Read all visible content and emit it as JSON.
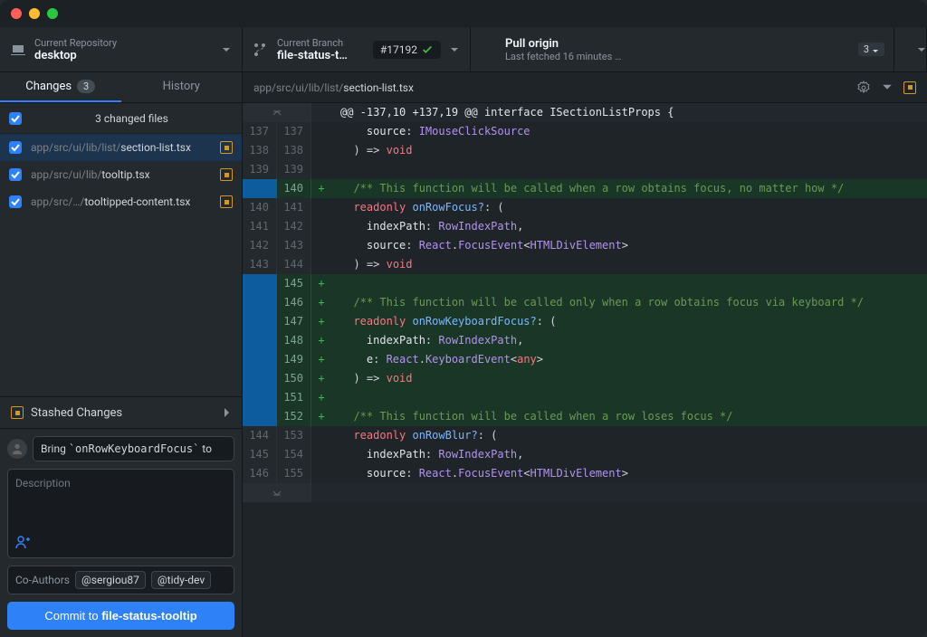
{
  "toolbar": {
    "repo": {
      "label": "Current Repository",
      "value": "desktop"
    },
    "branch": {
      "label": "Current Branch",
      "value": "file-status-t…",
      "pr_number": "#17192"
    },
    "fetch": {
      "label": "Pull origin",
      "sub": "Last fetched 16 minutes …",
      "count": "3"
    }
  },
  "tabs": {
    "changes": "Changes",
    "changes_count": "3",
    "history": "History"
  },
  "files": {
    "header": "3 changed files",
    "items": [
      {
        "dir": "app/src/ui/lib/list/",
        "name": "section-list.tsx"
      },
      {
        "dir": "app/src/ui/lib/",
        "name": "tooltip.tsx"
      },
      {
        "dir": "app/src/…/",
        "name": "tooltipped-content.tsx"
      }
    ]
  },
  "stashed": "Stashed Changes",
  "commit": {
    "summary_pre": "Bring ",
    "summary_code": "`onRowKeyboardFocus`",
    "summary_post": " to",
    "desc_placeholder": "Description",
    "coauthors_label": "Co-Authors",
    "handles": [
      "@sergiou87",
      "@tidy-dev"
    ],
    "btn_pre": "Commit to ",
    "btn_bold": "file-status-tooltip"
  },
  "file_header": {
    "dir": "app/src/ui/lib/list/",
    "name": "section-list.tsx"
  },
  "diff": [
    {
      "t": "hunk",
      "o": "",
      "n": "",
      "m": "",
      "segs": [
        [
          "plain",
          "@@ -137,10 +137,19 @@ interface ISectionListProps {"
        ]
      ]
    },
    {
      "t": "ctx",
      "o": "137",
      "n": "137",
      "m": "",
      "segs": [
        [
          "plain",
          "    source"
        ],
        [
          "punc",
          ": "
        ],
        [
          "type",
          "IMouseClickSource"
        ]
      ]
    },
    {
      "t": "ctx",
      "o": "138",
      "n": "138",
      "m": "",
      "segs": [
        [
          "punc",
          "  ) "
        ],
        [
          "punc",
          "=> "
        ],
        [
          "kw",
          "void"
        ]
      ]
    },
    {
      "t": "ctx",
      "o": "139",
      "n": "139",
      "m": "",
      "segs": [
        [
          "plain",
          ""
        ]
      ]
    },
    {
      "t": "add",
      "o": "",
      "n": "140",
      "m": "+",
      "segs": [
        [
          "comment",
          "  /** This function will be called when a row obtains focus, no matter how */"
        ]
      ]
    },
    {
      "t": "ctx",
      "o": "140",
      "n": "141",
      "m": "",
      "segs": [
        [
          "kw",
          "  readonly"
        ],
        [
          "plain",
          " "
        ],
        [
          "prop",
          "onRowFocus?"
        ],
        [
          "punc",
          ": ("
        ]
      ]
    },
    {
      "t": "ctx",
      "o": "141",
      "n": "142",
      "m": "",
      "segs": [
        [
          "plain",
          "    indexPath"
        ],
        [
          "punc",
          ": "
        ],
        [
          "type",
          "RowIndexPath"
        ],
        [
          "punc",
          ","
        ]
      ]
    },
    {
      "t": "ctx",
      "o": "142",
      "n": "143",
      "m": "",
      "segs": [
        [
          "plain",
          "    source"
        ],
        [
          "punc",
          ": "
        ],
        [
          "type",
          "React"
        ],
        [
          "punc",
          "."
        ],
        [
          "type",
          "FocusEvent"
        ],
        [
          "punc",
          "<"
        ],
        [
          "type",
          "HTMLDivElement"
        ],
        [
          "punc",
          ">"
        ]
      ]
    },
    {
      "t": "ctx",
      "o": "143",
      "n": "144",
      "m": "",
      "segs": [
        [
          "punc",
          "  ) "
        ],
        [
          "punc",
          "=> "
        ],
        [
          "kw",
          "void"
        ]
      ]
    },
    {
      "t": "add",
      "o": "",
      "n": "145",
      "m": "+",
      "segs": [
        [
          "plain",
          ""
        ]
      ]
    },
    {
      "t": "add",
      "o": "",
      "n": "146",
      "m": "+",
      "segs": [
        [
          "comment",
          "  /** This function will be called only when a row obtains focus via keyboard */"
        ]
      ]
    },
    {
      "t": "add",
      "o": "",
      "n": "147",
      "m": "+",
      "segs": [
        [
          "kw",
          "  readonly"
        ],
        [
          "plain",
          " "
        ],
        [
          "prop",
          "onRowKeyboardFocus?"
        ],
        [
          "punc",
          ": ("
        ]
      ]
    },
    {
      "t": "add",
      "o": "",
      "n": "148",
      "m": "+",
      "segs": [
        [
          "plain",
          "    indexPath"
        ],
        [
          "punc",
          ": "
        ],
        [
          "type",
          "RowIndexPath"
        ],
        [
          "punc",
          ","
        ]
      ]
    },
    {
      "t": "add",
      "o": "",
      "n": "149",
      "m": "+",
      "segs": [
        [
          "plain",
          "    e"
        ],
        [
          "punc",
          ": "
        ],
        [
          "type",
          "React"
        ],
        [
          "punc",
          "."
        ],
        [
          "type",
          "KeyboardEvent"
        ],
        [
          "punc",
          "<"
        ],
        [
          "kw",
          "any"
        ],
        [
          "punc",
          ">"
        ]
      ]
    },
    {
      "t": "add",
      "o": "",
      "n": "150",
      "m": "+",
      "segs": [
        [
          "punc",
          "  ) "
        ],
        [
          "punc",
          "=> "
        ],
        [
          "kw",
          "void"
        ]
      ]
    },
    {
      "t": "add",
      "o": "",
      "n": "151",
      "m": "+",
      "segs": [
        [
          "plain",
          ""
        ]
      ]
    },
    {
      "t": "add",
      "o": "",
      "n": "152",
      "m": "+",
      "segs": [
        [
          "comment",
          "  /** This function will be called when a row loses focus */"
        ]
      ]
    },
    {
      "t": "ctx",
      "o": "144",
      "n": "153",
      "m": "",
      "segs": [
        [
          "kw",
          "  readonly"
        ],
        [
          "plain",
          " "
        ],
        [
          "prop",
          "onRowBlur?"
        ],
        [
          "punc",
          ": ("
        ]
      ]
    },
    {
      "t": "ctx",
      "o": "145",
      "n": "154",
      "m": "",
      "segs": [
        [
          "plain",
          "    indexPath"
        ],
        [
          "punc",
          ": "
        ],
        [
          "type",
          "RowIndexPath"
        ],
        [
          "punc",
          ","
        ]
      ]
    },
    {
      "t": "ctx",
      "o": "146",
      "n": "155",
      "m": "",
      "segs": [
        [
          "plain",
          "    source"
        ],
        [
          "punc",
          ": "
        ],
        [
          "type",
          "React"
        ],
        [
          "punc",
          "."
        ],
        [
          "type",
          "FocusEvent"
        ],
        [
          "punc",
          "<"
        ],
        [
          "type",
          "HTMLDivElement"
        ],
        [
          "punc",
          ">"
        ]
      ]
    }
  ]
}
